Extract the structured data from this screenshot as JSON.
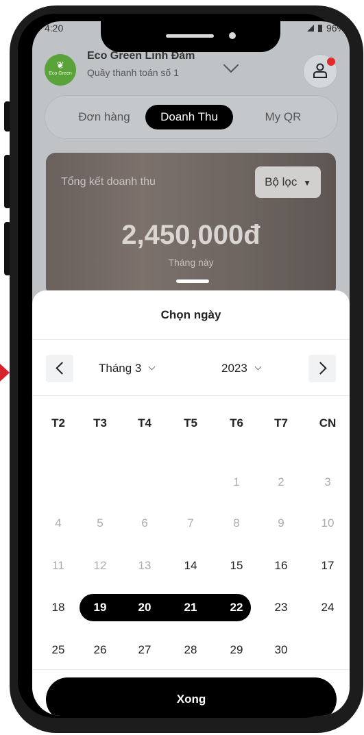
{
  "status": {
    "time": "4:20",
    "battery": "96%"
  },
  "header": {
    "store_name": "Eco Green Linh Đàm",
    "counter": "Quầy thanh toán số 1",
    "logo_text": "Eco Green"
  },
  "tabs": [
    {
      "label": "Đơn hàng",
      "active": false
    },
    {
      "label": "Doanh Thu",
      "active": true
    },
    {
      "label": "My QR",
      "active": false
    }
  ],
  "summary": {
    "title": "Tổng kết doanh thu",
    "filter_label": "Bộ lọc",
    "amount": "2,450,000đ",
    "period": "Tháng này"
  },
  "date_picker": {
    "title": "Chọn ngày",
    "month": "Tháng 3",
    "year": "2023",
    "weekdays": [
      "T2",
      "T3",
      "T4",
      "T5",
      "T6",
      "T7",
      "CN"
    ],
    "weeks": [
      [
        "",
        "",
        "",
        "",
        "1",
        "2",
        "3"
      ],
      [
        "4",
        "5",
        "6",
        "7",
        "8",
        "9",
        "10"
      ],
      [
        "11",
        "12",
        "13",
        "14",
        "15",
        "16",
        "17"
      ],
      [
        "18",
        "19",
        "20",
        "21",
        "22",
        "23",
        "24"
      ],
      [
        "25",
        "26",
        "27",
        "28",
        "29",
        "30",
        ""
      ]
    ],
    "muted_days": [
      "1",
      "2",
      "3",
      "4",
      "5",
      "6",
      "7",
      "8",
      "9",
      "10",
      "11",
      "12",
      "13"
    ],
    "selected_days": [
      "19",
      "20",
      "21",
      "22"
    ],
    "done_label": "Xong"
  }
}
